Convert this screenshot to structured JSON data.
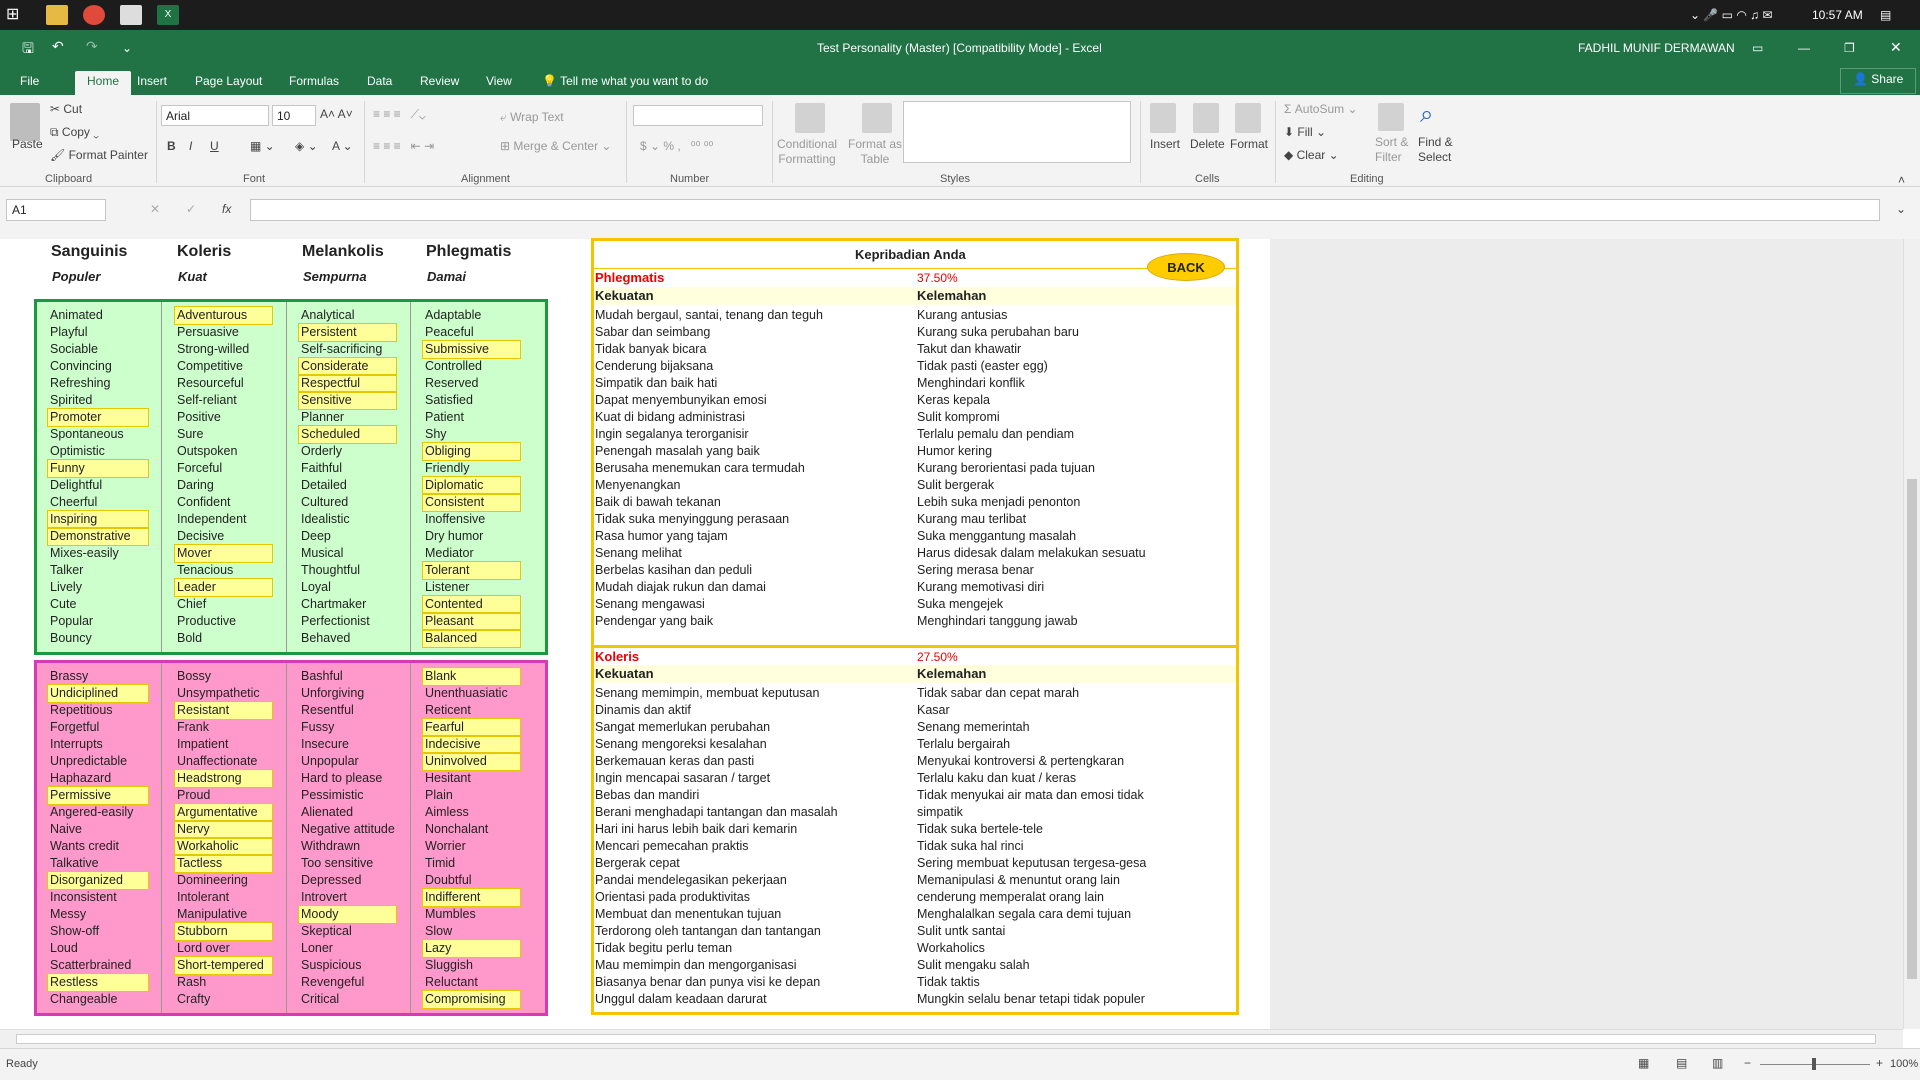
{
  "taskbar": {
    "time": "10:57 AM"
  },
  "window": {
    "title": "Test Personality (Master)  [Compatibility Mode] - Excel",
    "user": "FADHIL MUNIF DERMAWAN",
    "share": "Share"
  },
  "tabs": [
    "File",
    "Home",
    "Insert",
    "Page Layout",
    "Formulas",
    "Data",
    "Review",
    "View"
  ],
  "tell_me": "Tell me what you want to do",
  "ribbon": {
    "clipboard": {
      "paste": "Paste",
      "cut": "Cut",
      "copy": "Copy",
      "painter": "Format Painter",
      "label": "Clipboard"
    },
    "font": {
      "name": "Arial",
      "size": "10",
      "label": "Font"
    },
    "alignment": {
      "wrap": "Wrap Text",
      "merge": "Merge & Center",
      "label": "Alignment"
    },
    "number": {
      "label": "Number",
      "currency": "$",
      "percent": "%"
    },
    "styles": {
      "conditional": "Conditional",
      "conditional2": "Formatting",
      "format_as": "Format as",
      "format_as2": "Table",
      "label": "Styles"
    },
    "cells": {
      "insert": "Insert",
      "delete": "Delete",
      "format": "Format",
      "label": "Cells"
    },
    "editing": {
      "autosum": "AutoSum",
      "fill": "Fill",
      "clear": "Clear",
      "sort": "Sort &",
      "sort2": "Filter",
      "find": "Find &",
      "find2": "Select",
      "label": "Editing"
    }
  },
  "formula_bar": {
    "name_box": "A1",
    "fx": "fx",
    "value": ""
  },
  "types": {
    "headers": [
      "Sanguinis",
      "Koleris",
      "Melankolis",
      "Phlegmatis"
    ],
    "subheaders": [
      "Populer",
      "Kuat",
      "Sempurna",
      "Damai"
    ]
  },
  "strengths": [
    [
      {
        "t": "Animated"
      },
      {
        "t": "Playful"
      },
      {
        "t": "Sociable"
      },
      {
        "t": "Convincing"
      },
      {
        "t": "Refreshing"
      },
      {
        "t": "Spirited"
      },
      {
        "t": "Promoter",
        "h": 1
      },
      {
        "t": "Spontaneous"
      },
      {
        "t": "Optimistic"
      },
      {
        "t": "Funny",
        "h": 1
      },
      {
        "t": "Delightful"
      },
      {
        "t": "Cheerful"
      },
      {
        "t": "Inspiring",
        "h": 1
      },
      {
        "t": "Demonstrative",
        "h": 1
      },
      {
        "t": "Mixes-easily"
      },
      {
        "t": "Talker"
      },
      {
        "t": "Lively"
      },
      {
        "t": "Cute"
      },
      {
        "t": "Popular"
      },
      {
        "t": "Bouncy"
      }
    ],
    [
      {
        "t": "Adventurous",
        "h": 1
      },
      {
        "t": "Persuasive"
      },
      {
        "t": "Strong-willed"
      },
      {
        "t": "Competitive"
      },
      {
        "t": "Resourceful"
      },
      {
        "t": "Self-reliant"
      },
      {
        "t": "Positive"
      },
      {
        "t": "Sure"
      },
      {
        "t": "Outspoken"
      },
      {
        "t": "Forceful"
      },
      {
        "t": "Daring"
      },
      {
        "t": "Confident"
      },
      {
        "t": "Independent"
      },
      {
        "t": "Decisive"
      },
      {
        "t": "Mover",
        "h": 1
      },
      {
        "t": "Tenacious"
      },
      {
        "t": "Leader",
        "h": 1
      },
      {
        "t": "Chief"
      },
      {
        "t": "Productive"
      },
      {
        "t": "Bold"
      }
    ],
    [
      {
        "t": "Analytical"
      },
      {
        "t": "Persistent",
        "h": 1
      },
      {
        "t": "Self-sacrificing"
      },
      {
        "t": "Considerate",
        "h": 1
      },
      {
        "t": "Respectful",
        "h": 1
      },
      {
        "t": "Sensitive",
        "h": 1
      },
      {
        "t": "Planner"
      },
      {
        "t": "Scheduled",
        "h": 1
      },
      {
        "t": "Orderly"
      },
      {
        "t": "Faithful"
      },
      {
        "t": "Detailed"
      },
      {
        "t": "Cultured"
      },
      {
        "t": "Idealistic"
      },
      {
        "t": "Deep"
      },
      {
        "t": "Musical"
      },
      {
        "t": "Thoughtful"
      },
      {
        "t": "Loyal"
      },
      {
        "t": "Chartmaker"
      },
      {
        "t": "Perfectionist"
      },
      {
        "t": "Behaved"
      }
    ],
    [
      {
        "t": "Adaptable"
      },
      {
        "t": "Peaceful"
      },
      {
        "t": "Submissive",
        "h": 1
      },
      {
        "t": "Controlled"
      },
      {
        "t": "Reserved"
      },
      {
        "t": "Satisfied"
      },
      {
        "t": "Patient"
      },
      {
        "t": "Shy"
      },
      {
        "t": "Obliging",
        "h": 1
      },
      {
        "t": "Friendly"
      },
      {
        "t": "Diplomatic",
        "h": 1
      },
      {
        "t": "Consistent",
        "h": 1
      },
      {
        "t": "Inoffensive"
      },
      {
        "t": "Dry humor"
      },
      {
        "t": "Mediator"
      },
      {
        "t": "Tolerant",
        "h": 1
      },
      {
        "t": "Listener"
      },
      {
        "t": "Contented",
        "h": 1
      },
      {
        "t": "Pleasant",
        "h": 1
      },
      {
        "t": "Balanced",
        "h": 1
      }
    ]
  ],
  "weaknesses": [
    [
      {
        "t": "Brassy"
      },
      {
        "t": "Undiciplined",
        "h": 1
      },
      {
        "t": "Repetitious"
      },
      {
        "t": "Forgetful"
      },
      {
        "t": "Interrupts"
      },
      {
        "t": "Unpredictable"
      },
      {
        "t": "Haphazard"
      },
      {
        "t": "Permissive",
        "h": 1
      },
      {
        "t": "Angered-easily"
      },
      {
        "t": "Naive"
      },
      {
        "t": "Wants credit"
      },
      {
        "t": "Talkative"
      },
      {
        "t": "Disorganized",
        "h": 1
      },
      {
        "t": "Inconsistent"
      },
      {
        "t": "Messy"
      },
      {
        "t": "Show-off"
      },
      {
        "t": "Loud"
      },
      {
        "t": "Scatterbrained"
      },
      {
        "t": "Restless",
        "h": 1
      },
      {
        "t": "Changeable"
      }
    ],
    [
      {
        "t": "Bossy"
      },
      {
        "t": "Unsympathetic"
      },
      {
        "t": "Resistant",
        "h": 1
      },
      {
        "t": "Frank"
      },
      {
        "t": "Impatient"
      },
      {
        "t": "Unaffectionate"
      },
      {
        "t": "Headstrong",
        "h": 1
      },
      {
        "t": "Proud"
      },
      {
        "t": "Argumentative",
        "h": 1
      },
      {
        "t": "Nervy",
        "h": 1
      },
      {
        "t": "Workaholic",
        "h": 1
      },
      {
        "t": "Tactless",
        "h": 1
      },
      {
        "t": "Domineering"
      },
      {
        "t": "Intolerant"
      },
      {
        "t": "Manipulative"
      },
      {
        "t": "Stubborn",
        "h": 1
      },
      {
        "t": "Lord over"
      },
      {
        "t": "Short-tempered",
        "h": 1
      },
      {
        "t": "Rash"
      },
      {
        "t": "Crafty"
      }
    ],
    [
      {
        "t": "Bashful"
      },
      {
        "t": "Unforgiving"
      },
      {
        "t": "Resentful"
      },
      {
        "t": "Fussy"
      },
      {
        "t": "Insecure"
      },
      {
        "t": "Unpopular"
      },
      {
        "t": "Hard to please"
      },
      {
        "t": "Pessimistic"
      },
      {
        "t": "Alienated"
      },
      {
        "t": "Negative attitude"
      },
      {
        "t": "Withdrawn"
      },
      {
        "t": "Too sensitive"
      },
      {
        "t": "Depressed"
      },
      {
        "t": "Introvert"
      },
      {
        "t": "Moody",
        "h": 1
      },
      {
        "t": "Skeptical"
      },
      {
        "t": "Loner"
      },
      {
        "t": "Suspicious"
      },
      {
        "t": "Revengeful"
      },
      {
        "t": "Critical"
      }
    ],
    [
      {
        "t": "Blank",
        "h": 1
      },
      {
        "t": "Unenthuasiatic"
      },
      {
        "t": "Reticent"
      },
      {
        "t": "Fearful",
        "h": 1
      },
      {
        "t": "Indecisive",
        "h": 1
      },
      {
        "t": "Uninvolved",
        "h": 1
      },
      {
        "t": "Hesitant"
      },
      {
        "t": "Plain"
      },
      {
        "t": "Aimless"
      },
      {
        "t": "Nonchalant"
      },
      {
        "t": "Worrier"
      },
      {
        "t": "Timid"
      },
      {
        "t": "Doubtful"
      },
      {
        "t": "Indifferent",
        "h": 1
      },
      {
        "t": "Mumbles"
      },
      {
        "t": "Slow"
      },
      {
        "t": "Lazy",
        "h": 1
      },
      {
        "t": "Sluggish"
      },
      {
        "t": "Reluctant"
      },
      {
        "t": "Compromising",
        "h": 1
      }
    ]
  ],
  "result": {
    "title": "Kepribadian Anda",
    "back": "BACK",
    "sections": [
      {
        "name": "Phlegmatis",
        "pct": "37.50%",
        "k": "Kekuatan",
        "w": "Kelemahan",
        "left": [
          "Mudah bergaul, santai, tenang dan teguh",
          "Sabar dan seimbang",
          "Tidak banyak bicara",
          "Cenderung bijaksana",
          "Simpatik dan baik hati",
          "Dapat menyembunyikan emosi",
          "Kuat di bidang administrasi",
          "Ingin segalanya terorganisir",
          "Penengah masalah yang baik",
          "Berusaha menemukan cara termudah",
          "Menyenangkan",
          "Baik di bawah tekanan",
          "Tidak suka menyinggung perasaan",
          "Rasa humor yang tajam",
          "Senang melihat",
          "Berbelas kasihan dan peduli",
          "Mudah diajak rukun dan damai",
          "Senang mengawasi",
          "Pendengar yang baik"
        ],
        "right": [
          "Kurang antusias",
          "Kurang suka perubahan baru",
          "Takut dan khawatir",
          "Tidak pasti (easter egg)",
          "Menghindari konflik",
          "Keras kepala",
          "Sulit kompromi",
          "Terlalu pemalu dan pendiam",
          "Humor kering",
          "Kurang berorientasi pada tujuan",
          "Sulit bergerak",
          "Lebih suka menjadi penonton",
          "Kurang mau terlibat",
          "Suka menggantung masalah",
          "Harus didesak dalam melakukan sesuatu",
          "Sering merasa benar",
          "Kurang memotivasi diri",
          "Suka mengejek",
          "Menghindari tanggung jawab"
        ]
      },
      {
        "name": "Koleris",
        "pct": "27.50%",
        "k": "Kekuatan",
        "w": "Kelemahan",
        "left": [
          "Senang memimpin, membuat keputusan",
          "Dinamis dan aktif",
          "Sangat memerlukan perubahan",
          "Senang mengoreksi kesalahan",
          "Berkemauan keras dan pasti",
          "Ingin mencapai sasaran / target",
          "Bebas dan mandiri",
          "Berani menghadapi tantangan dan masalah",
          "Hari ini harus lebih baik dari kemarin",
          "Mencari pemecahan praktis",
          "Bergerak cepat",
          "Pandai mendelegasikan pekerjaan",
          "Orientasi pada produktivitas",
          "Membuat dan menentukan tujuan",
          "Terdorong oleh tantangan dan tantangan",
          "Tidak begitu perlu teman",
          "Mau memimpin dan mengorganisasi",
          "Biasanya benar dan punya visi ke depan",
          "Unggul dalam keadaan darurat"
        ],
        "right": [
          "Tidak sabar dan cepat marah",
          "Kasar",
          "Senang memerintah",
          "Terlalu bergairah",
          "Menyukai kontroversi & pertengkaran",
          "Terlalu kaku dan kuat / keras",
          "Tidak menyukai air mata dan emosi tidak",
          "simpatik",
          "Tidak suka bertele-tele",
          "Tidak suka hal rinci",
          "Sering membuat keputusan tergesa-gesa",
          "Memanipulasi & menuntut orang lain",
          "cenderung memperalat orang lain",
          "Menghalalkan segala cara demi tujuan",
          "Sulit untk santai",
          "Workaholics",
          "Sulit mengaku salah",
          "Tidak taktis",
          "Mungkin selalu benar tetapi tidak populer"
        ]
      }
    ]
  },
  "status": {
    "ready": "Ready",
    "zoom": "100%"
  }
}
